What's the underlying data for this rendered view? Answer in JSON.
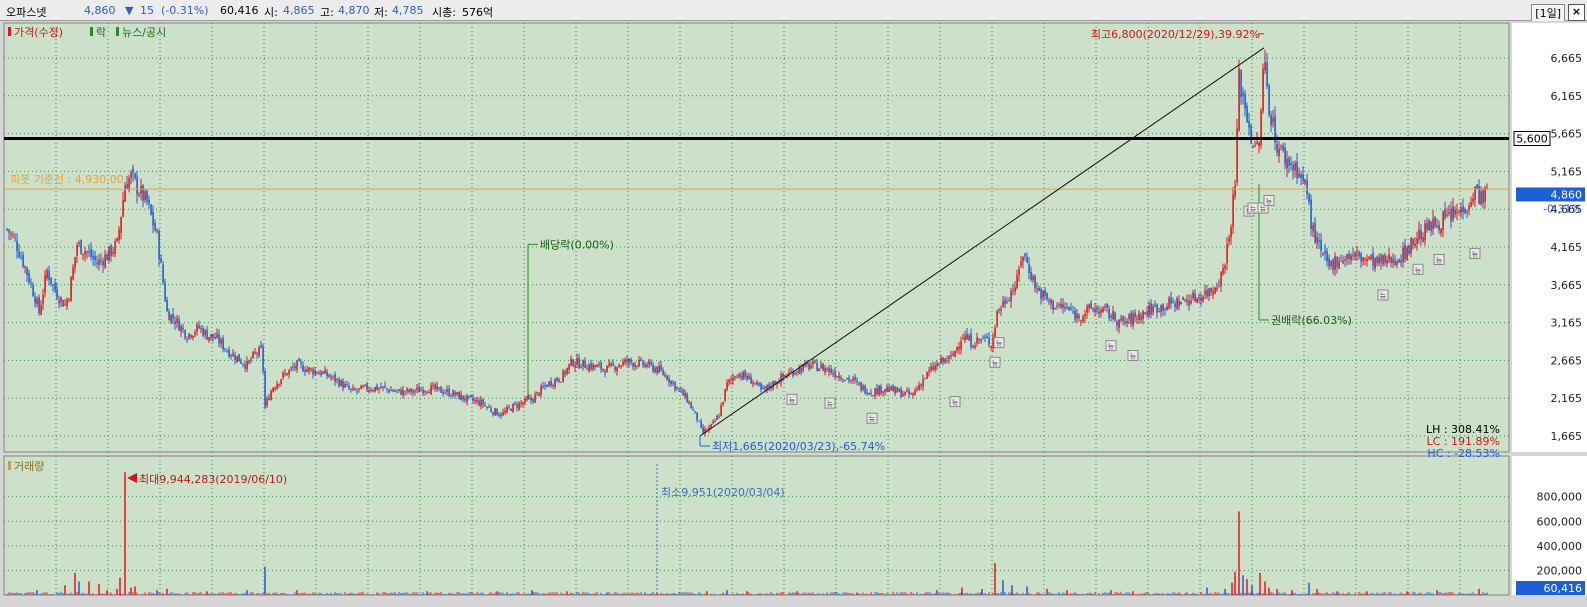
{
  "header": {
    "name": "오파스넷",
    "price": "4,860",
    "change_arrow": "▼",
    "change": "15",
    "change_pct": "(-0.31%)",
    "volume": "60,416",
    "open_label": "시:",
    "open": "4,865",
    "high_label": "고:",
    "high": "4,870",
    "low_label": "저:",
    "low": "4,785",
    "mcap_label": "시총:",
    "mcap": "576억",
    "period": "[1일]",
    "close_icon": "close-icon"
  },
  "legend": {
    "price": "가격(수정)",
    "ex": "락",
    "news": "뉴스/공시",
    "volume": "거래량"
  },
  "colors": {
    "background": "#cde0c9",
    "grid": "#3e8e4a",
    "up": "#e8151c",
    "down": "#1d5fd6",
    "pivot": "#e8a33a",
    "resistance": "#000000",
    "event": "#2c8a2c"
  },
  "chart_data": [
    {
      "type": "candlestick",
      "title": "가격(수정)",
      "ylim": [
        1500,
        7000
      ],
      "y_ticks": [
        "6,665",
        "6,165",
        "5,665",
        "5,165",
        "4,665",
        "4,165",
        "3,665",
        "3,165",
        "2,665",
        "2,165",
        "1,665"
      ],
      "x_start": "2019-04",
      "x_end": "2021-11",
      "keypoints": [
        [
          0,
          4400
        ],
        [
          8,
          4250
        ],
        [
          18,
          3900
        ],
        [
          28,
          3500
        ],
        [
          32,
          3300
        ],
        [
          40,
          3850
        ],
        [
          46,
          3650
        ],
        [
          52,
          3500
        ],
        [
          58,
          3400
        ],
        [
          62,
          3550
        ],
        [
          70,
          4200
        ],
        [
          80,
          4100
        ],
        [
          90,
          3950
        ],
        [
          100,
          4050
        ],
        [
          110,
          4200
        ],
        [
          118,
          5000
        ],
        [
          124,
          5100
        ],
        [
          130,
          4950
        ],
        [
          140,
          4750
        ],
        [
          150,
          4300
        ],
        [
          155,
          3800
        ],
        [
          160,
          3300
        ],
        [
          168,
          3200
        ],
        [
          180,
          3000
        ],
        [
          192,
          3100
        ],
        [
          200,
          3000
        ],
        [
          210,
          2950
        ],
        [
          220,
          2800
        ],
        [
          230,
          2700
        ],
        [
          240,
          2600
        ],
        [
          248,
          2750
        ],
        [
          255,
          2800
        ],
        [
          258,
          2050
        ],
        [
          265,
          2300
        ],
        [
          275,
          2450
        ],
        [
          290,
          2600
        ],
        [
          300,
          2550
        ],
        [
          315,
          2500
        ],
        [
          330,
          2400
        ],
        [
          345,
          2250
        ],
        [
          360,
          2300
        ],
        [
          375,
          2300
        ],
        [
          390,
          2250
        ],
        [
          405,
          2250
        ],
        [
          420,
          2300
        ],
        [
          440,
          2250
        ],
        [
          460,
          2150
        ],
        [
          475,
          2100
        ],
        [
          485,
          2000
        ],
        [
          495,
          1950
        ],
        [
          505,
          2050
        ],
        [
          515,
          2100
        ],
        [
          525,
          2150
        ],
        [
          540,
          2350
        ],
        [
          555,
          2450
        ],
        [
          565,
          2650
        ],
        [
          580,
          2600
        ],
        [
          600,
          2550
        ],
        [
          620,
          2650
        ],
        [
          640,
          2600
        ],
        [
          650,
          2550
        ],
        [
          660,
          2450
        ],
        [
          670,
          2300
        ],
        [
          680,
          2150
        ],
        [
          690,
          1900
        ],
        [
          695,
          1700
        ],
        [
          705,
          1800
        ],
        [
          712,
          1950
        ],
        [
          720,
          2350
        ],
        [
          730,
          2500
        ],
        [
          745,
          2400
        ],
        [
          755,
          2250
        ],
        [
          770,
          2400
        ],
        [
          790,
          2550
        ],
        [
          805,
          2600
        ],
        [
          820,
          2550
        ],
        [
          835,
          2450
        ],
        [
          845,
          2400
        ],
        [
          855,
          2300
        ],
        [
          865,
          2250
        ],
        [
          878,
          2300
        ],
        [
          890,
          2250
        ],
        [
          905,
          2200
        ],
        [
          915,
          2400
        ],
        [
          925,
          2550
        ],
        [
          935,
          2650
        ],
        [
          945,
          2700
        ],
        [
          955,
          3000
        ],
        [
          965,
          2900
        ],
        [
          975,
          2950
        ],
        [
          985,
          2900
        ],
        [
          990,
          3300
        ],
        [
          1000,
          3500
        ],
        [
          1010,
          3700
        ],
        [
          1015,
          4100
        ],
        [
          1020,
          3950
        ],
        [
          1030,
          3600
        ],
        [
          1045,
          3400
        ],
        [
          1060,
          3350
        ],
        [
          1070,
          3250
        ],
        [
          1085,
          3350
        ],
        [
          1100,
          3300
        ],
        [
          1115,
          3150
        ],
        [
          1130,
          3250
        ],
        [
          1145,
          3350
        ],
        [
          1160,
          3400
        ],
        [
          1175,
          3450
        ],
        [
          1190,
          3500
        ],
        [
          1205,
          3600
        ],
        [
          1215,
          3800
        ],
        [
          1222,
          4300
        ],
        [
          1228,
          5000
        ],
        [
          1232,
          6400
        ],
        [
          1240,
          5900
        ],
        [
          1248,
          5400
        ],
        [
          1253,
          5650
        ],
        [
          1257,
          6700
        ],
        [
          1262,
          6050
        ],
        [
          1270,
          5500
        ],
        [
          1280,
          5300
        ],
        [
          1290,
          5200
        ],
        [
          1300,
          4900
        ],
        [
          1305,
          4400
        ],
        [
          1315,
          4050
        ],
        [
          1322,
          3900
        ],
        [
          1330,
          4000
        ],
        [
          1345,
          4050
        ],
        [
          1360,
          4000
        ],
        [
          1372,
          3950
        ],
        [
          1385,
          4000
        ],
        [
          1395,
          4050
        ],
        [
          1410,
          4300
        ],
        [
          1425,
          4450
        ],
        [
          1440,
          4550
        ],
        [
          1455,
          4650
        ],
        [
          1468,
          4900
        ],
        [
          1475,
          4830
        ],
        [
          1480,
          4860
        ]
      ],
      "min_close": 1665,
      "max_high": 6800,
      "pivot": {
        "label": "피봇 기준선 : 4,930.00",
        "value": 4930
      },
      "resistance": {
        "value": 5600,
        "label": "5,600"
      },
      "current": {
        "price": "4,860",
        "change": "-0.31%",
        "value": 4860
      },
      "trendline": {
        "from": [
          693,
          1665
        ],
        "to": [
          1257,
          6800
        ]
      },
      "annotations": {
        "max": "최고6,800(2020/12/29),39.92%",
        "min": "최저1,665(2020/03/23),-65.74%",
        "dividend": "배당락(0.00%)",
        "rights": "권배락(66.03%)"
      },
      "stats": {
        "lh": "LH : 308.41%",
        "lc": "LC : 191.89%",
        "hc": "HC : -28.53%"
      },
      "news_label": "뉴",
      "news_markers": [
        [
          785,
          2150
        ],
        [
          823,
          2100
        ],
        [
          865,
          1900
        ],
        [
          948,
          2120
        ],
        [
          988,
          2640
        ],
        [
          992,
          2900
        ],
        [
          1104,
          2860
        ],
        [
          1126,
          2730
        ],
        [
          1242,
          4640
        ],
        [
          1246,
          4680
        ],
        [
          1256,
          4680
        ],
        [
          1262,
          4780
        ],
        [
          1376,
          3530
        ],
        [
          1411,
          3870
        ],
        [
          1432,
          4000
        ],
        [
          1468,
          4080
        ]
      ]
    },
    {
      "type": "bar",
      "title": "거래량",
      "ylim": [
        0,
        1050000
      ],
      "y_ticks": [
        "800,000",
        "600,000",
        "400,000",
        "200,000"
      ],
      "current_volume": "60,416",
      "max_label": "최대9,944,283(2019/06/10)",
      "min_label": "최소9,951(2020/03/04)",
      "spikes": [
        [
          30,
          40000
        ],
        [
          58,
          80000
        ],
        [
          68,
          180000
        ],
        [
          72,
          110000
        ],
        [
          82,
          110000
        ],
        [
          92,
          90000
        ],
        [
          100,
          40000
        ],
        [
          110,
          50000
        ],
        [
          113,
          140000
        ],
        [
          118,
          1000000
        ],
        [
          124,
          60000
        ],
        [
          128,
          70000
        ],
        [
          150,
          40000
        ],
        [
          160,
          50000
        ],
        [
          200,
          30000
        ],
        [
          240,
          40000
        ],
        [
          258,
          230000
        ],
        [
          290,
          40000
        ],
        [
          420,
          30000
        ],
        [
          490,
          30000
        ],
        [
          525,
          40000
        ],
        [
          560,
          30000
        ],
        [
          600,
          20000
        ],
        [
          650,
          20000
        ],
        [
          700,
          30000
        ],
        [
          720,
          40000
        ],
        [
          740,
          30000
        ],
        [
          790,
          30000
        ],
        [
          850,
          20000
        ],
        [
          930,
          40000
        ],
        [
          955,
          60000
        ],
        [
          975,
          50000
        ],
        [
          988,
          260000
        ],
        [
          996,
          120000
        ],
        [
          1005,
          80000
        ],
        [
          1020,
          70000
        ],
        [
          1040,
          50000
        ],
        [
          1060,
          40000
        ],
        [
          1104,
          40000
        ],
        [
          1126,
          30000
        ],
        [
          1200,
          60000
        ],
        [
          1218,
          50000
        ],
        [
          1225,
          100000
        ],
        [
          1228,
          190000
        ],
        [
          1232,
          680000
        ],
        [
          1236,
          160000
        ],
        [
          1240,
          130000
        ],
        [
          1245,
          80000
        ],
        [
          1253,
          180000
        ],
        [
          1258,
          110000
        ],
        [
          1262,
          60000
        ],
        [
          1270,
          50000
        ],
        [
          1285,
          40000
        ],
        [
          1302,
          100000
        ],
        [
          1310,
          50000
        ],
        [
          1330,
          30000
        ],
        [
          1360,
          30000
        ],
        [
          1400,
          30000
        ],
        [
          1430,
          40000
        ],
        [
          1472,
          50000
        ]
      ]
    }
  ]
}
